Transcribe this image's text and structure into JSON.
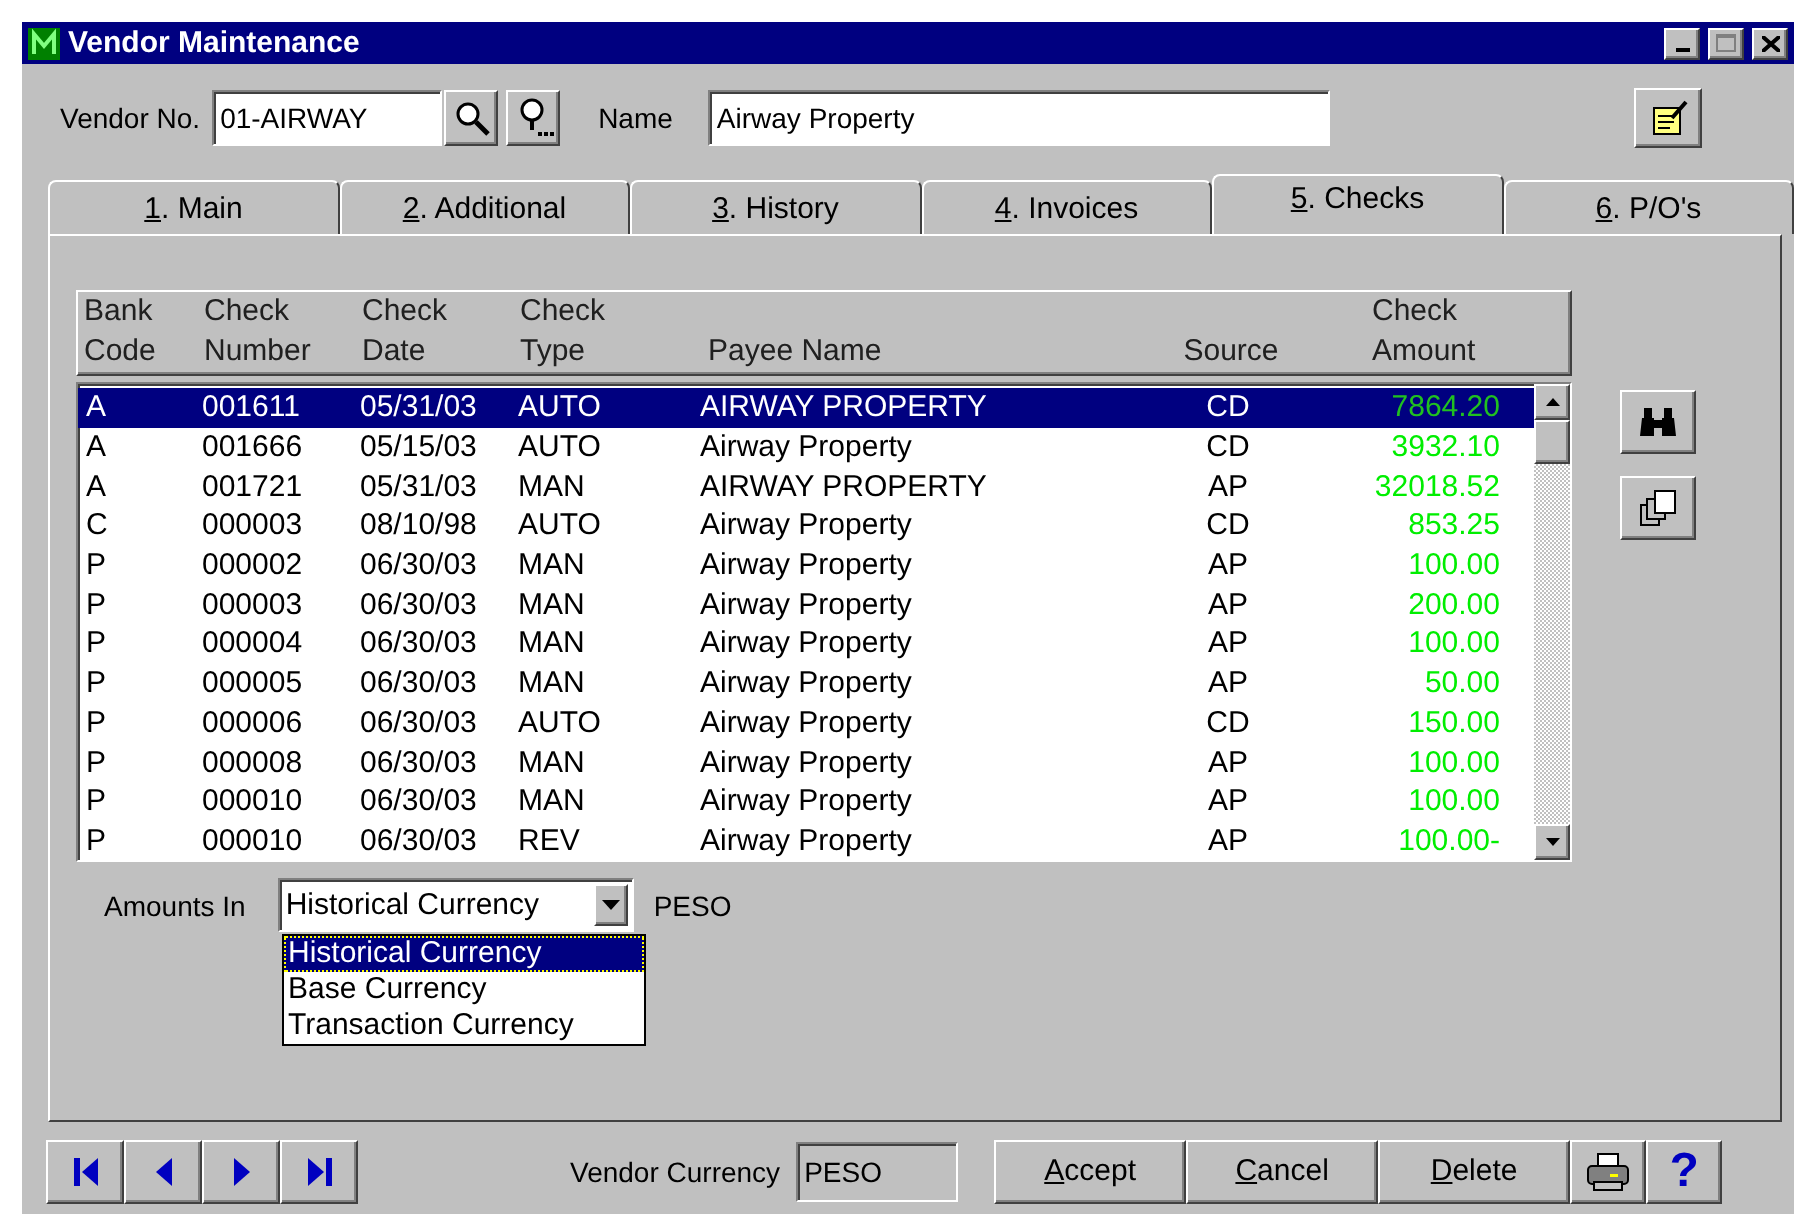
{
  "window": {
    "title": "Vendor Maintenance"
  },
  "vendor": {
    "label": "Vendor No.",
    "value": "01-AIRWAY",
    "name_label": "Name",
    "name_value": "Airway Property"
  },
  "tabs": [
    {
      "access_key": "1",
      "label_rest": ". Main",
      "selected": false
    },
    {
      "access_key": "2",
      "label_rest": ". Additional",
      "selected": false
    },
    {
      "access_key": "3",
      "label_rest": ". History",
      "selected": false
    },
    {
      "access_key": "4",
      "label_rest": ". Invoices",
      "selected": false
    },
    {
      "access_key": "5",
      "label_rest": ". Checks",
      "selected": true
    },
    {
      "access_key": "6",
      "label_rest": ". P/O's",
      "selected": false
    }
  ],
  "table": {
    "columns": [
      {
        "line1": "Bank",
        "line2": "Code"
      },
      {
        "line1": "Check",
        "line2": "Number"
      },
      {
        "line1": "Check",
        "line2": "Date"
      },
      {
        "line1": "Check",
        "line2": "Type"
      },
      {
        "line2": "Payee Name"
      },
      {
        "line2": "Source"
      },
      {
        "line1": "Check",
        "line2": "Amount"
      }
    ],
    "rows": [
      {
        "cells": [
          "A",
          "001611",
          "05/31/03",
          "AUTO",
          "AIRWAY PROPERTY",
          "CD",
          "7864.20"
        ],
        "selected": true
      },
      {
        "cells": [
          "A",
          "001666",
          "05/15/03",
          "AUTO",
          "Airway Property",
          "CD",
          "3932.10"
        ],
        "selected": false
      },
      {
        "cells": [
          "A",
          "001721",
          "05/31/03",
          "MAN",
          "AIRWAY PROPERTY",
          "AP",
          "32018.52"
        ],
        "selected": false
      },
      {
        "cells": [
          "C",
          "000003",
          "08/10/98",
          "AUTO",
          "Airway Property",
          "CD",
          "853.25"
        ],
        "selected": false
      },
      {
        "cells": [
          "P",
          "000002",
          "06/30/03",
          "MAN",
          "Airway Property",
          "AP",
          "100.00"
        ],
        "selected": false
      },
      {
        "cells": [
          "P",
          "000003",
          "06/30/03",
          "MAN",
          "Airway Property",
          "AP",
          "200.00"
        ],
        "selected": false
      },
      {
        "cells": [
          "P",
          "000004",
          "06/30/03",
          "MAN",
          "Airway Property",
          "AP",
          "100.00"
        ],
        "selected": false
      },
      {
        "cells": [
          "P",
          "000005",
          "06/30/03",
          "MAN",
          "Airway Property",
          "AP",
          "50.00"
        ],
        "selected": false
      },
      {
        "cells": [
          "P",
          "000006",
          "06/30/03",
          "AUTO",
          "Airway Property",
          "CD",
          "150.00"
        ],
        "selected": false
      },
      {
        "cells": [
          "P",
          "000008",
          "06/30/03",
          "MAN",
          "Airway Property",
          "AP",
          "100.00"
        ],
        "selected": false
      },
      {
        "cells": [
          "P",
          "000010",
          "06/30/03",
          "MAN",
          "Airway Property",
          "AP",
          "100.00"
        ],
        "selected": false
      },
      {
        "cells": [
          "P",
          "000010",
          "06/30/03",
          "REV",
          "Airway Property",
          "AP",
          "100.00-"
        ],
        "selected": false
      }
    ]
  },
  "amounts": {
    "label": "Amounts In",
    "value": "Historical Currency",
    "currency": "PESO",
    "options": [
      {
        "label": "Historical Currency",
        "selected": true
      },
      {
        "label": "Base Currency",
        "selected": false
      },
      {
        "label": "Transaction Currency",
        "selected": false
      }
    ]
  },
  "footer": {
    "currency_label": "Vendor Currency",
    "currency_value": "PESO",
    "buttons": [
      {
        "access_key": "A",
        "label_rest": "ccept"
      },
      {
        "access_key": "C",
        "label_rest": "ancel"
      },
      {
        "access_key": "D",
        "label_rest": "elete"
      }
    ],
    "help": "?"
  }
}
